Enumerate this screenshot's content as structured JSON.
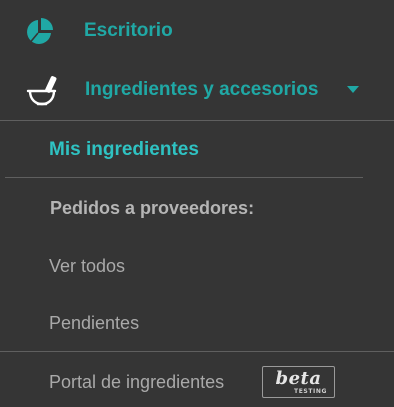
{
  "colors": {
    "background": "#353535",
    "accent": "#20a8a5",
    "active": "#2fc2c2",
    "muted_text": "#a9a9a9",
    "heading_text": "#b5b5b5",
    "divider": "#5f5f5f"
  },
  "menu": {
    "dashboard": {
      "label": "Escritorio",
      "icon": "pie-chart-icon"
    },
    "ingredients": {
      "label": "Ingredientes y accesorios",
      "icon": "mortar-pestle-icon",
      "caret": "caret-down-icon",
      "expanded": true,
      "submenu": {
        "my_ingredients": {
          "label": "Mis ingredientes",
          "active": true
        },
        "supplier_orders_heading": "Pedidos a proveedores:",
        "view_all": "Ver todos",
        "pending": "Pendientes",
        "portal": {
          "label": "Portal de ingredientes",
          "badge_main": "beta",
          "badge_sub": "TESTING"
        }
      }
    }
  }
}
